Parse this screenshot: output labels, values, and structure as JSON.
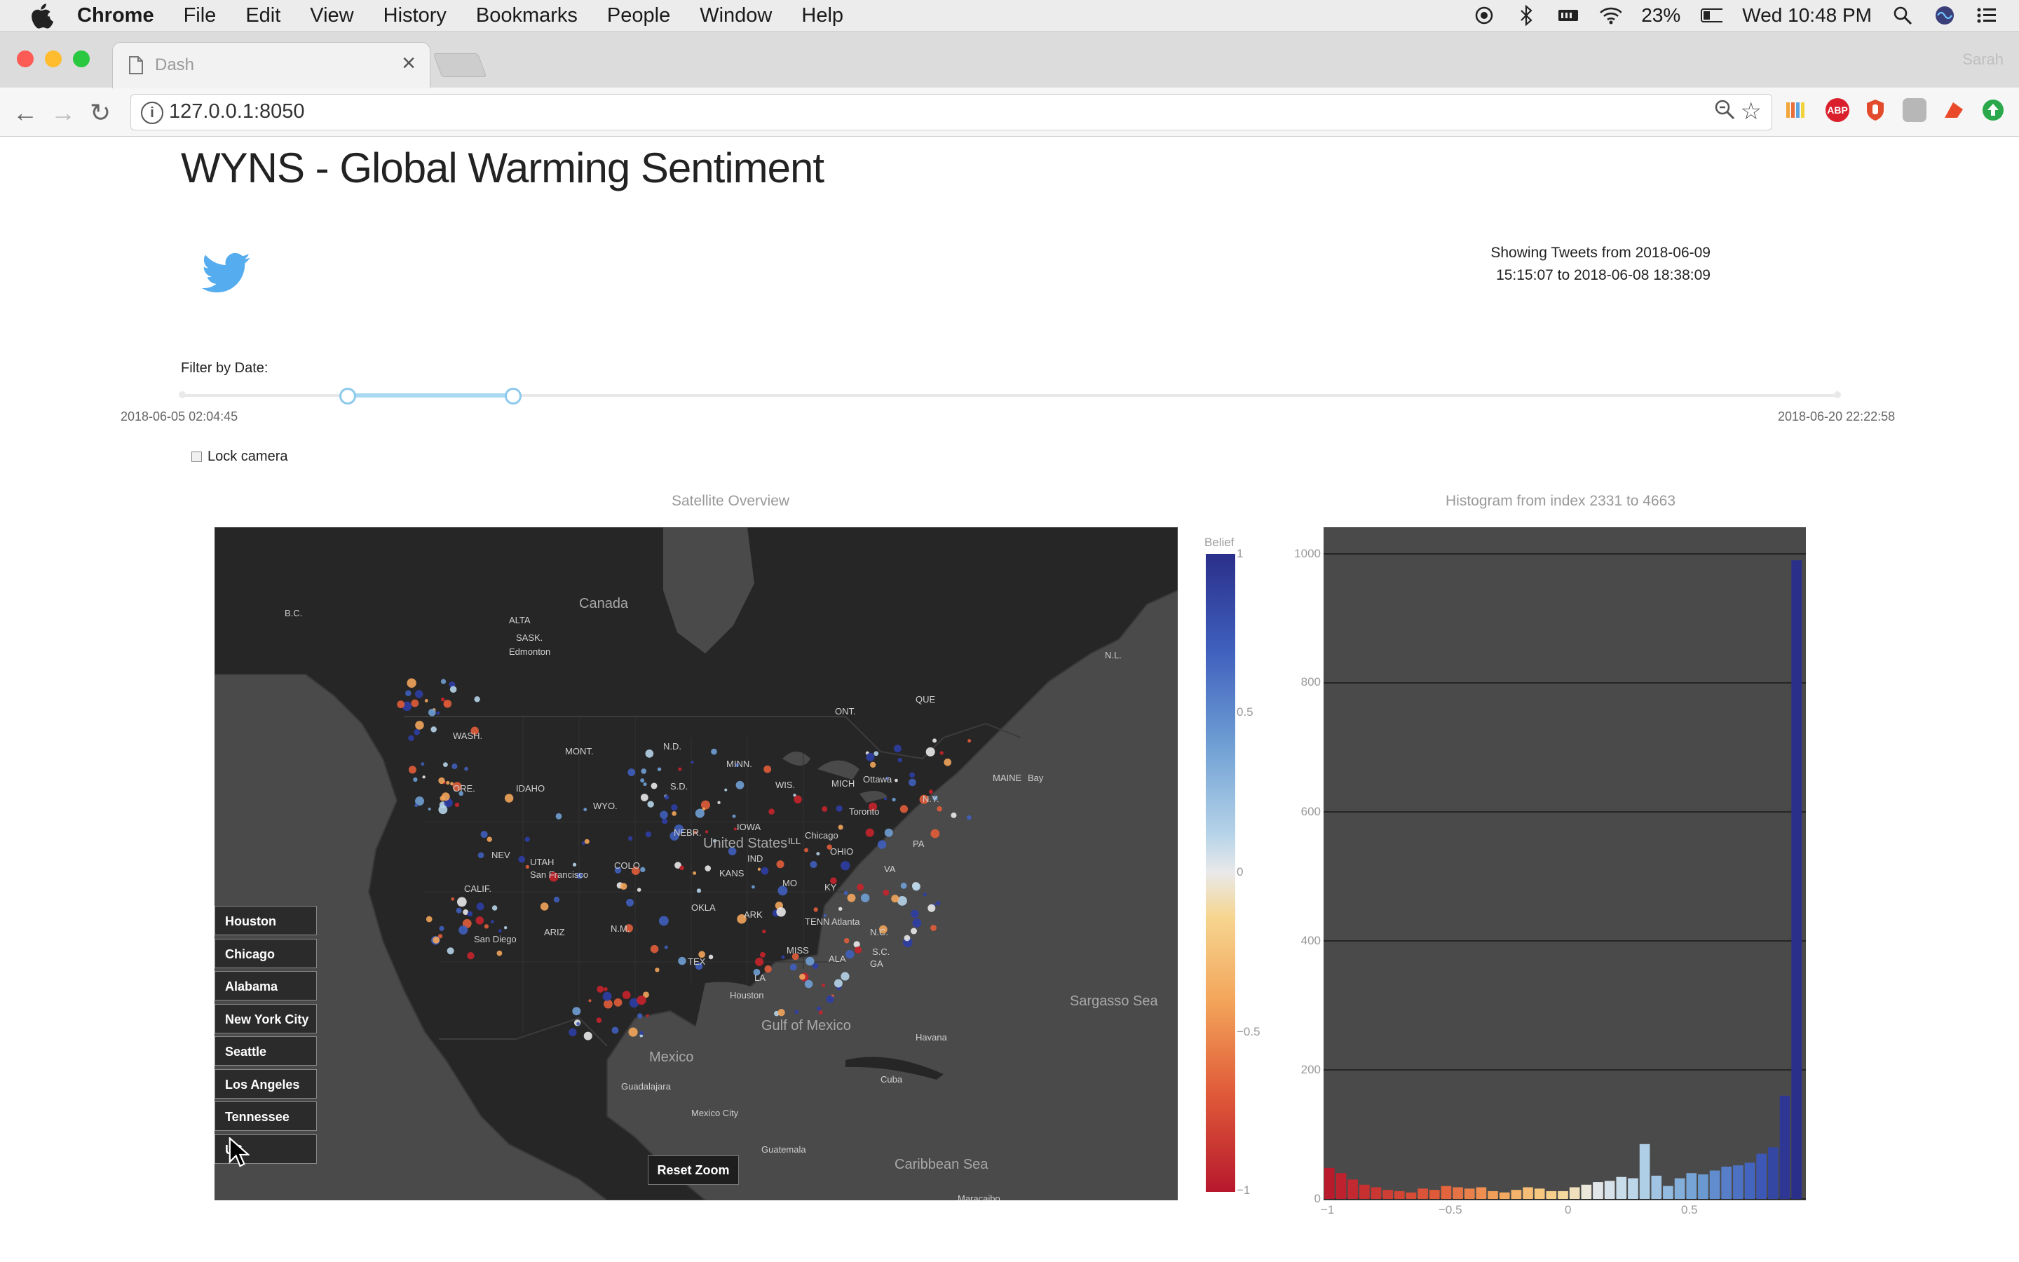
{
  "os_menu": {
    "items": [
      "Chrome",
      "File",
      "Edit",
      "View",
      "History",
      "Bookmarks",
      "People",
      "Window",
      "Help"
    ],
    "battery": "23%",
    "clock": "Wed 10:48 PM"
  },
  "browser": {
    "tab_title": "Dash",
    "profile_name": "Sarah",
    "url": "127.0.0.1:8050",
    "extensions": [
      {
        "name": "bookmarks-ext-icon",
        "color": "#e8a33d",
        "label": ""
      },
      {
        "name": "adblock-plus-icon",
        "color": "#d9202c",
        "label": "ABP"
      },
      {
        "name": "shield-ext-icon",
        "color": "#e24b2b",
        "label": ""
      },
      {
        "name": "grey-ext-icon",
        "color": "#b7b7b7",
        "label": ""
      },
      {
        "name": "red-ext-icon",
        "color": "#ea4a2a",
        "label": ""
      },
      {
        "name": "green-ext-icon",
        "color": "#2aa84b",
        "label": ""
      }
    ]
  },
  "page": {
    "title": "WYNS - Global Warming Sentiment",
    "showing_line1": "Showing Tweets from 2018-06-09",
    "showing_line2": "15:15:07 to 2018-06-08 18:38:09",
    "filter_label": "Filter by Date:",
    "slider_min": "2018-06-05 02:04:45",
    "slider_max": "2018-06-20 22:22:58",
    "slider_range_fraction": [
      0.1,
      0.2
    ],
    "lock_camera": "Lock camera",
    "lock_camera_checked": false
  },
  "map": {
    "title": "Satellite Overview",
    "reset_zoom": "Reset Zoom",
    "city_buttons": [
      "Houston",
      "Chicago",
      "Alabama",
      "New York City",
      "Seattle",
      "Los Angeles",
      "Tennessee",
      "US"
    ],
    "place_labels": [
      "Canada",
      "B.C.",
      "ALTA",
      "SASK.",
      "Edmonton",
      "ONT.",
      "QUE",
      "N.L.",
      "WASH.",
      "MONT.",
      "N.D.",
      "MINN.",
      "ORE.",
      "IDAHO",
      "WYO.",
      "S.D.",
      "WIS.",
      "MICH",
      "Ottawa",
      "Toronto",
      "MAINE",
      "N.Y.",
      "NEBR.",
      "IOWA",
      "NEV",
      "UTAH",
      "COLO",
      "United States",
      "ILL",
      "IND",
      "OHIO",
      "PA",
      "Chicago",
      "San Francisco",
      "CALIF.",
      "KANS",
      "MO",
      "KY",
      "VA",
      "ARIZ",
      "N.M.",
      "OKLA",
      "ARK",
      "TENN",
      "N.C.",
      "S.C.",
      "Atlanta",
      "San Diego",
      "TEX",
      "MISS",
      "ALA",
      "GA",
      "LA",
      "Houston",
      "Gulf of Mexico",
      "Mexico",
      "Guadalajara",
      "Mexico City",
      "Sargasso Sea",
      "Caribbean Sea",
      "Bay",
      "Maracaibo",
      "Havana",
      "Cuba",
      "Guatemala"
    ]
  },
  "colorbar": {
    "title": "Belief",
    "ticks": [
      "1",
      "0.5",
      "0",
      "−0.5",
      "−1"
    ]
  },
  "histogram": {
    "title": "Histogram from index 2331 to 4663",
    "y_ticks": [
      "1000",
      "800",
      "600",
      "400",
      "200",
      "0"
    ],
    "x_ticks": [
      "−1",
      "−0.5",
      "0",
      "0.5"
    ],
    "bar_colors": {
      "negative": "#c8232c",
      "neutral": "#f1d585",
      "positive": "#3a55b0"
    }
  },
  "chart_data": {
    "type": "bar",
    "title": "Histogram from index 2331 to 4663",
    "xlabel": "",
    "ylabel": "",
    "xlim": [
      -1,
      1
    ],
    "ylim": [
      0,
      1000
    ],
    "x": [
      -0.975,
      -0.925,
      -0.875,
      -0.825,
      -0.775,
      -0.725,
      -0.675,
      -0.625,
      -0.575,
      -0.525,
      -0.475,
      -0.425,
      -0.375,
      -0.325,
      -0.275,
      -0.225,
      -0.175,
      -0.125,
      -0.075,
      -0.025,
      0.025,
      0.075,
      0.125,
      0.175,
      0.225,
      0.275,
      0.325,
      0.375,
      0.425,
      0.475,
      0.525,
      0.575,
      0.625,
      0.675,
      0.725,
      0.775,
      0.825,
      0.875,
      0.925,
      0.975
    ],
    "values": [
      48,
      40,
      30,
      22,
      18,
      14,
      12,
      10,
      16,
      14,
      20,
      18,
      16,
      18,
      12,
      10,
      14,
      18,
      16,
      12,
      12,
      18,
      22,
      26,
      28,
      34,
      32,
      85,
      36,
      20,
      32,
      40,
      38,
      44,
      50,
      52,
      56,
      70,
      80,
      160
    ],
    "last_bar_value": 990
  }
}
